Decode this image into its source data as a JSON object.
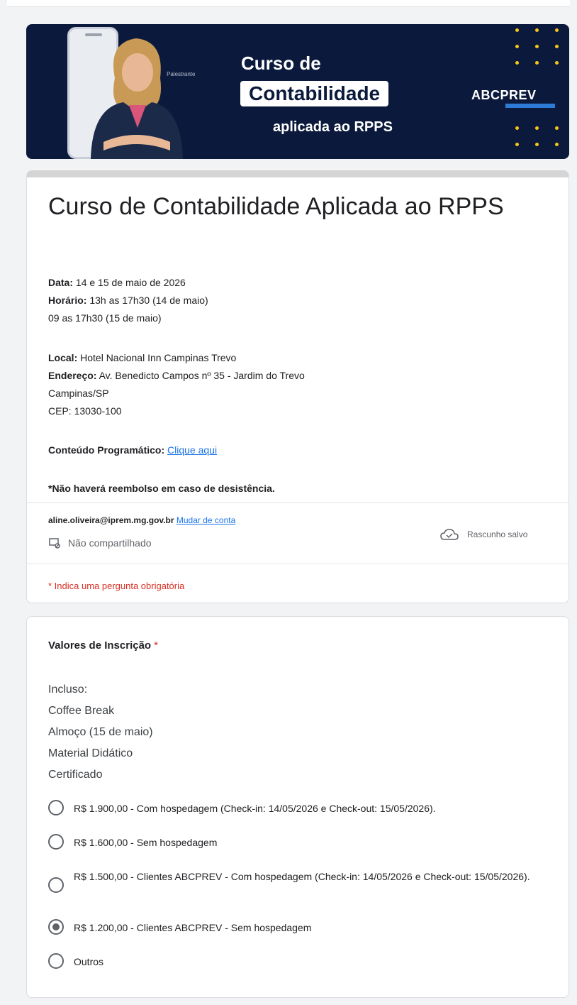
{
  "banner": {
    "small_caption": "Palestrante",
    "title_line1": "Curso de",
    "title_boxed": "Contabilidade",
    "title_line3": "aplicada ao RPPS",
    "logo": "ABCPREV"
  },
  "form": {
    "title": "Curso de Contabilidade Aplicada ao RPPS",
    "data_label": "Data:",
    "data_value": "14 e 15 de maio de 2026",
    "horario_label": "Horário:",
    "horario_value": "13h as 17h30 (14 de maio)",
    "horario_value2": "09 as 17h30 (15 de maio)",
    "local_label": "Local:",
    "local_value": "Hotel Nacional Inn Campinas Trevo",
    "endereco_label": "Endereço:",
    "endereco_value": "Av. Benedicto Campos nº 35 - Jardim do Trevo",
    "cidade": "Campinas/SP",
    "cep": "CEP: 13030-100",
    "conteudo_label": "Conteúdo Programático:",
    "conteudo_link": "Clique aqui",
    "reembolso": "*Não haverá reembolso em caso de desistência."
  },
  "account": {
    "email": "aline.oliveira@iprem.mg.gov.br",
    "switch_link": "Mudar de conta",
    "not_shared": "Não compartilhado",
    "draft_status": "Rascunho salvo",
    "required_note": "* Indica uma pergunta obrigatória"
  },
  "question": {
    "title": "Valores de Inscrição",
    "required_mark": "*",
    "desc_lines": [
      "Incluso:",
      "Coffee Break",
      "Almoço (15 de maio)",
      "Material Didático",
      "Certificado"
    ],
    "options": [
      "R$ 1.900,00 - Com hospedagem (Check-in: 14/05/2026 e Check-out: 15/05/2026).",
      "R$ 1.600,00 - Sem hospedagem",
      "R$ 1.500,00 - Clientes ABCPREV - Com hospedagem (Check-in: 14/05/2026 e Check-out: 15/05/2026).",
      "R$ 1.200,00 - Clientes ABCPREV - Sem hospedagem",
      "Outros"
    ],
    "selected_index": 3
  }
}
